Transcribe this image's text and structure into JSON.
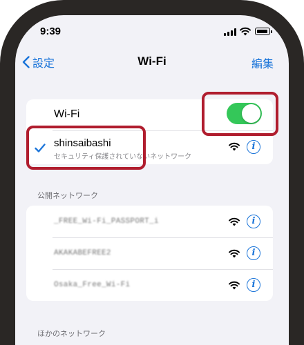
{
  "status_bar": {
    "time": "9:39"
  },
  "nav": {
    "back_label": "設定",
    "title": "Wi-Fi",
    "edit_label": "編集"
  },
  "wifi_toggle": {
    "label": "Wi-Fi",
    "state": "on"
  },
  "connected_network": {
    "ssid": "shinsaibashi",
    "subtitle": "セキュリティ保護されていないネットワーク"
  },
  "public_networks": {
    "header": "公開ネットワーク",
    "items": [
      {
        "name": "_FREE_Wi-Fi_PASSPORT_i"
      },
      {
        "name": "AKAKABEFREE2"
      },
      {
        "name": "Osaka_Free_Wi-Fi"
      }
    ]
  },
  "other_networks": {
    "header": "ほかのネットワーク"
  },
  "colors": {
    "accent": "#1a74d9",
    "toggle_on": "#34c759",
    "highlight": "#b01d2e"
  }
}
